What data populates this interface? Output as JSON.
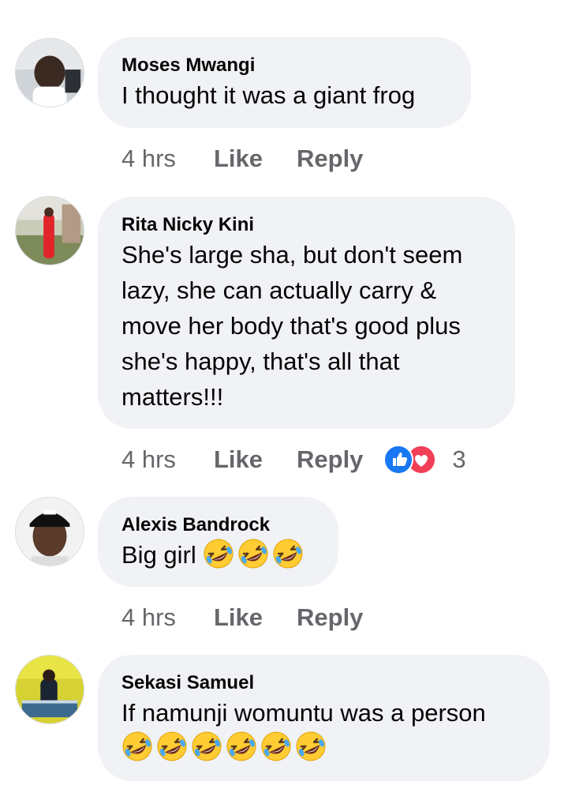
{
  "comments": [
    {
      "author": "Moses Mwangi",
      "text": "I thought it was a giant frog",
      "time": "4 hrs",
      "like": "Like",
      "reply": "Reply"
    },
    {
      "author": "Rita Nicky Kini",
      "text_lines": [
        "She's large sha, but don't seem",
        "lazy, she can actually carry &",
        "move her body that's good plus",
        "she's happy, that's all that",
        "matters!!!"
      ],
      "time": "4 hrs",
      "like": "Like",
      "reply": "Reply",
      "reactions": {
        "icons": [
          "like-reaction-icon",
          "love-reaction-icon"
        ],
        "count": "3"
      }
    },
    {
      "author": "Alexis Bandrock",
      "text": "Big girl",
      "emoji_count": 3,
      "time": "4 hrs",
      "like": "Like",
      "reply": "Reply"
    },
    {
      "author": "Sekasi Samuel",
      "text": "If namunji womuntu was a person",
      "emoji_count": 6
    }
  ],
  "colors": {
    "bubble": "#f0f2f5",
    "meta_text": "#65676b",
    "like_blue": "#1877f2",
    "love_red": "#f33e58"
  },
  "icons": {
    "emoji": "rolling-on-floor-laughing-icon"
  }
}
